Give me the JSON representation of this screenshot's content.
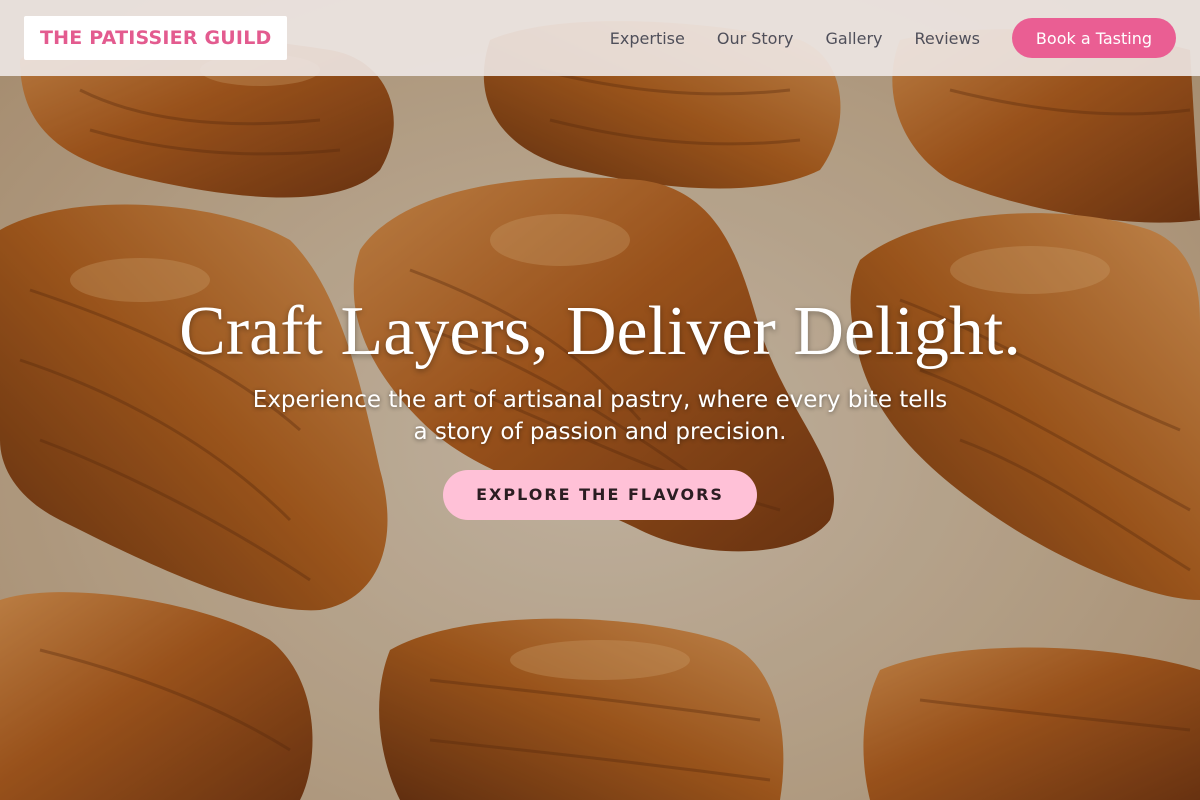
{
  "header": {
    "logo_text": "THE PATISSIER GUILD",
    "nav_links": [
      "Expertise",
      "Our Story",
      "Gallery",
      "Reviews"
    ],
    "cta_label": "Book a Tasting"
  },
  "hero": {
    "headline": "Craft Layers, Deliver Delight.",
    "subheadline": "Experience the art of artisanal pastry, where every bite tells a story of passion and precision.",
    "button_label": "EXPLORE THE FLAVORS",
    "background_image": "croissants-on-baking-paper"
  },
  "colors": {
    "brand_pink": "#e35b8f",
    "cta_pink": "#ea5e93",
    "button_light_pink": "#ffc1d7",
    "nav_text": "#4f4f5a"
  }
}
